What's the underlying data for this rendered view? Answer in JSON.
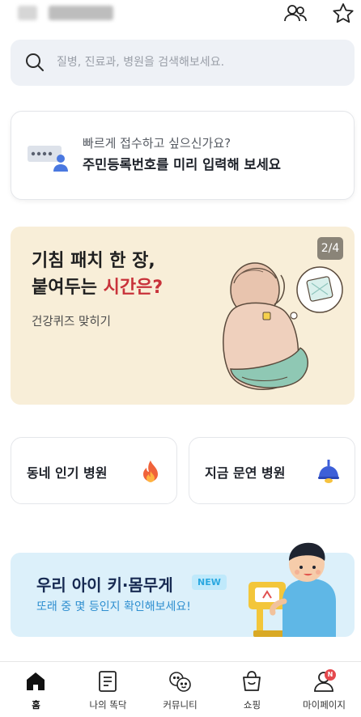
{
  "search": {
    "placeholder": "질병, 진료과, 병원을 검색해보세요."
  },
  "id_card": {
    "subtitle": "빠르게 접수하고 싶으신가요?",
    "title": "주민등록번호를 미리 입력해 보세요"
  },
  "banner": {
    "title_line1": "기침 패치 한 장,",
    "title_line2_prefix": "붙여두는 ",
    "title_line2_highlight": "시간은?",
    "subtitle": "건강퀴즈 맞히기",
    "page_indicator": "2/4",
    "highlight_color": "#c8323a"
  },
  "tiles": [
    {
      "label": "동네 인기 병원",
      "icon": "fire-icon"
    },
    {
      "label": "지금 문연 병원",
      "icon": "lamp-icon"
    }
  ],
  "promo": {
    "title": "우리 아이 키·몸무게",
    "badge": "NEW",
    "subtitle": "또래 중 몇 등인지 확인해보세요!"
  },
  "tabbar": {
    "items": [
      {
        "label": "홈",
        "icon": "home-icon",
        "active": true
      },
      {
        "label": "나의 똑닥",
        "icon": "document-icon",
        "active": false
      },
      {
        "label": "커뮤니티",
        "icon": "community-icon",
        "active": false
      },
      {
        "label": "쇼핑",
        "icon": "shopping-bag-icon",
        "active": false
      },
      {
        "label": "마이페이지",
        "icon": "profile-icon",
        "active": false,
        "badge": "N"
      }
    ]
  }
}
